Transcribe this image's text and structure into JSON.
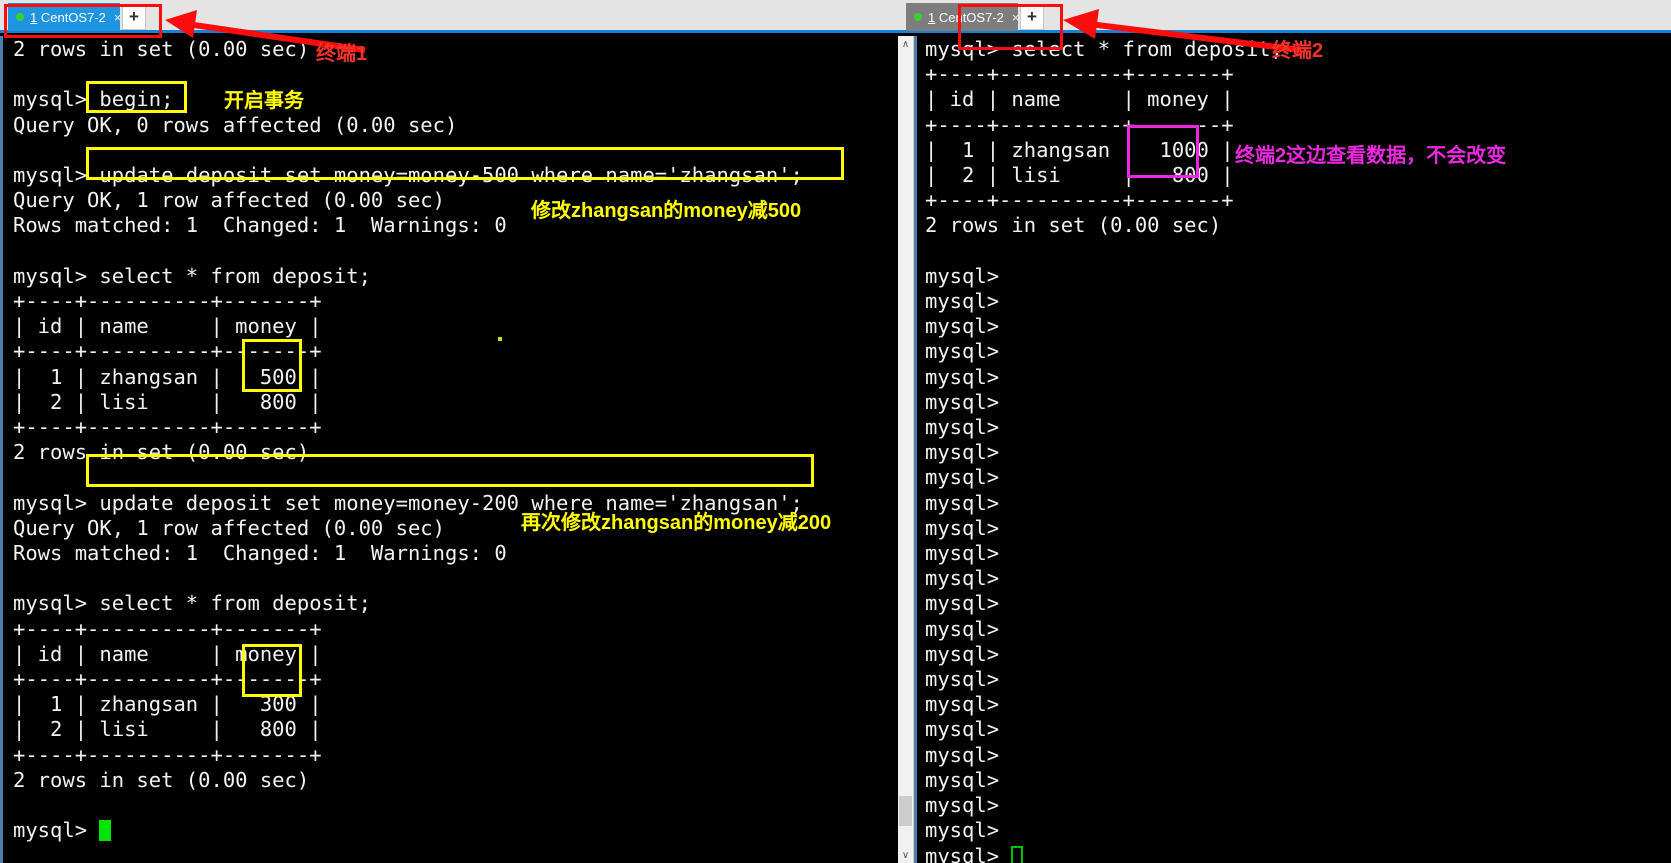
{
  "window_left": {
    "tab": {
      "number": "1",
      "title": " CentOS7-2",
      "close_icon": "×",
      "new_tab_label": "+"
    },
    "terminal_text": "2 rows in set (0.00 sec)\n\nmysql> begin;\nQuery OK, 0 rows affected (0.00 sec)\n\nmysql> update deposit set money=money-500 where name='zhangsan';\nQuery OK, 1 row affected (0.00 sec)\nRows matched: 1  Changed: 1  Warnings: 0\n\nmysql> select * from deposit;\n+----+----------+-------+\n| id | name     | money |\n+----+----------+-------+\n|  1 | zhangsan |   500 |\n|  2 | lisi     |   800 |\n+----+----------+-------+\n2 rows in set (0.00 sec)\n\nmysql> update deposit set money=money-200 where name='zhangsan';\nQuery OK, 1 row affected (0.00 sec)\nRows matched: 1  Changed: 1  Warnings: 0\n\nmysql> select * from deposit;\n+----+----------+-------+\n| id | name     | money |\n+----+----------+-------+\n|  1 | zhangsan |   300 |\n|  2 | lisi     |   800 |\n+----+----------+-------+\n2 rows in set (0.00 sec)\n\nmysql> ",
    "prompt_final": "mysql> "
  },
  "window_right": {
    "tab": {
      "number": "1",
      "title": " CentOS7-2",
      "close_icon": "×",
      "new_tab_label": "+"
    },
    "nav": {
      "back_icon": "◀",
      "forward_icon": "▶",
      "menu_icon": "▾"
    },
    "scrollbar": {
      "up_icon": "∧",
      "down_icon": "∨"
    },
    "terminal_text": "mysql> select * from deposit;\n+----+----------+-------+\n| id | name     | money |\n+----+----------+-------+\n|  1 | zhangsan |  1000 |\n|  2 | lisi     |   800 |\n+----+----------+-------+\n2 rows in set (0.00 sec)\n\nmysql>\nmysql>\nmysql>\nmysql>\nmysql>\nmysql>\nmysql>\nmysql>\nmysql>\nmysql>\nmysql>\nmysql>\nmysql>\nmysql>\nmysql>\nmysql>\nmysql>\nmysql>\nmysql>\nmysql>\nmysql>\nmysql>\nmysql>\nmysql> ",
    "prompt_final": "mysql> "
  },
  "annotations": {
    "terminal1_label": "终端1",
    "terminal2_label": "终端2",
    "begin_note": "开启事务",
    "update500_note": "修改zhangsan的money减500",
    "update200_note": "再次修改zhangsan的money减200",
    "terminal2_note": "终端2这边查看数据，不会改变"
  },
  "colors": {
    "highlight_yellow": "#ffff00",
    "highlight_magenta": "#ec28e0",
    "highlight_red": "#fb0d0d",
    "tab_active_blue": "#1e95e0",
    "tab_inactive_gray": "#7d7d7d",
    "cursor_green": "#00e400",
    "terminal_bg": "#000000",
    "terminal_fg": "#f2f2f2"
  },
  "sql_values": {
    "before": {
      "zhangsan": "1000",
      "lisi": "800"
    },
    "after_500": {
      "zhangsan": "500",
      "lisi": "800"
    },
    "after_200": {
      "zhangsan": "300",
      "lisi": "800"
    }
  }
}
